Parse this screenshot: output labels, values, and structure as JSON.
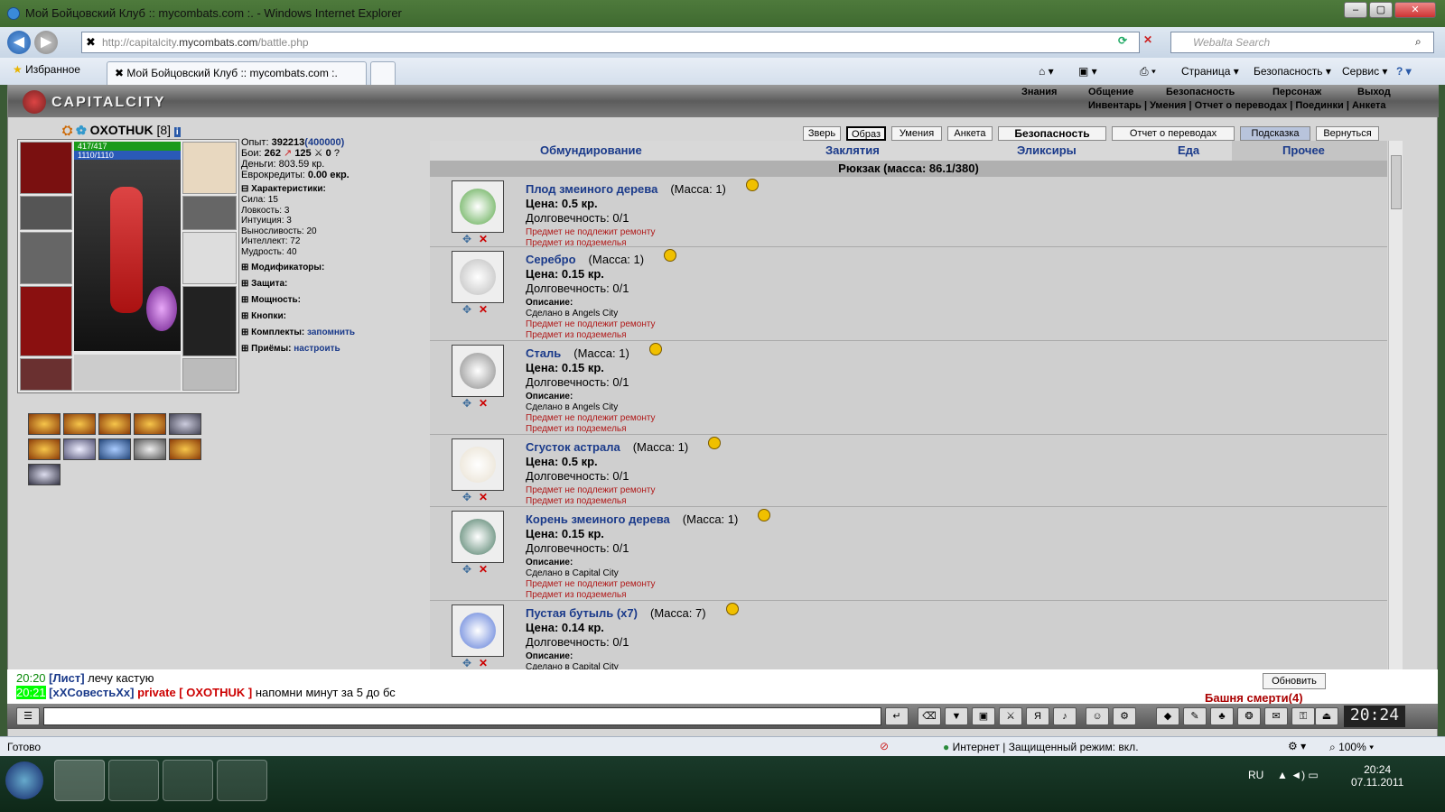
{
  "window": {
    "title": "Мой Бойцовский Клуб :: mycombats.com :. - Windows Internet Explorer"
  },
  "address": {
    "prefix": "http://capitalcity.",
    "domain": "mycombats.com",
    "path": "/battle.php"
  },
  "search": {
    "placeholder": "Webalta Search"
  },
  "favorites": {
    "label": "Избранное"
  },
  "tab": {
    "label": "Мой Бойцовский Клуб :: mycombats.com :."
  },
  "commands": [
    "Страница",
    "Безопасность",
    "Сервис"
  ],
  "game": {
    "logo": "CAPITALCITY",
    "menu1": [
      "Знания",
      "Общение",
      "Безопасность",
      "Персонаж",
      "Выход"
    ],
    "menu2": "Инвентарь | Умения | Отчет о переводах | Поединки | Анкета",
    "char": {
      "name": "OXOTHUK",
      "level": "[8]",
      "hp": "417/417",
      "mana": "1110/1110"
    },
    "stats": {
      "exp_label": "Опыт:",
      "exp": "392213",
      "exp_next": "(400000)",
      "fights_label": "Бои:",
      "fights": "262",
      "wins": "125",
      "losses": "0",
      "money_label": "Деньги:",
      "money": "803.59 кр.",
      "euro_label": "Еврокредиты:",
      "euro": "0.00 екр.",
      "char_hdr": "Характеристики:",
      "attrs": [
        "Сила: 15",
        "Ловкость: 3",
        "Интуиция: 3",
        "Выносливость: 20",
        "Интеллект: 72",
        "Мудрость: 40"
      ],
      "sections": [
        "Модификаторы:",
        "Защита:",
        "Мощность:",
        "Кнопки:"
      ],
      "sets": "Комплекты:",
      "sets_link": "запомнить",
      "moves": "Приёмы:",
      "moves_link": "настроить"
    },
    "topbuttons": [
      "Зверь",
      "Образ",
      "Умения",
      "Анкета",
      "Безопасность",
      "Отчет о переводах",
      "Подсказка",
      "Вернуться"
    ],
    "categories": [
      "Обмундирование",
      "Заклятия",
      "Эликсиры",
      "Еда",
      "Прочее"
    ],
    "backpack": "Рюкзак (масса: 86.1/380)",
    "items": [
      {
        "name": "Плод змеиного дерева",
        "mass": "(Масса: 1)",
        "price": "Цена: 0.5 кр.",
        "dur": "Долговечность: 0/1",
        "desc": "",
        "made": "",
        "lines": [
          "Предмет не подлежит ремонту",
          "Предмет из подземелья"
        ],
        "color": "#5aa84a"
      },
      {
        "name": "Серебро",
        "mass": "(Масса: 1)",
        "price": "Цена: 0.15 кр.",
        "dur": "Долговечность: 0/1",
        "desc": "Описание:",
        "made": "Сделано в Angels City",
        "lines": [
          "Предмет не подлежит ремонту",
          "Предмет из подземелья"
        ],
        "color": "#bdbdbd"
      },
      {
        "name": "Сталь",
        "mass": "(Масса: 1)",
        "price": "Цена: 0.15 кр.",
        "dur": "Долговечность: 0/1",
        "desc": "Описание:",
        "made": "Сделано в Angels City",
        "lines": [
          "Предмет не подлежит ремонту",
          "Предмет из подземелья"
        ],
        "color": "#8a8a8a"
      },
      {
        "name": "Сгусток астрала",
        "mass": "(Масса: 1)",
        "price": "Цена: 0.5 кр.",
        "dur": "Долговечность: 0/1",
        "desc": "",
        "made": "",
        "lines": [
          "Предмет не подлежит ремонту",
          "Предмет из подземелья"
        ],
        "color": "#e8e0d0"
      },
      {
        "name": "Корень змеиного дерева",
        "mass": "(Масса: 1)",
        "price": "Цена: 0.15 кр.",
        "dur": "Долговечность: 0/1",
        "desc": "Описание:",
        "made": "Сделано в Capital City",
        "lines": [
          "Предмет не подлежит ремонту",
          "Предмет из подземелья"
        ],
        "color": "#4a7a64"
      },
      {
        "name": "Пустая бутыль (x7)",
        "mass": "(Масса: 7)",
        "price": "Цена: 0.14 кр.",
        "dur": "Долговечность: 0/1",
        "desc": "Описание:",
        "made": "Сделано в Capital City",
        "lines": [],
        "color": "#5a7ad8"
      }
    ]
  },
  "chat": [
    {
      "time": "20:20",
      "who": "[Лист]",
      "text": "лечу кастую"
    },
    {
      "time": "20:21",
      "who": "[xXСовестьXx]",
      "priv": "private [ OXOTHUK ]",
      "text": "напомни минут за 5 до бс"
    }
  ],
  "chatside": {
    "refresh": "Обновить",
    "tower": "Башня смерти(4)"
  },
  "clock": "20:24",
  "status": {
    "left": "Готово",
    "zone": "Интернет | Защищенный режим: вкл.",
    "zoom": "100%"
  },
  "tray": {
    "lang": "RU",
    "time": "20:24",
    "date": "07.11.2011"
  }
}
